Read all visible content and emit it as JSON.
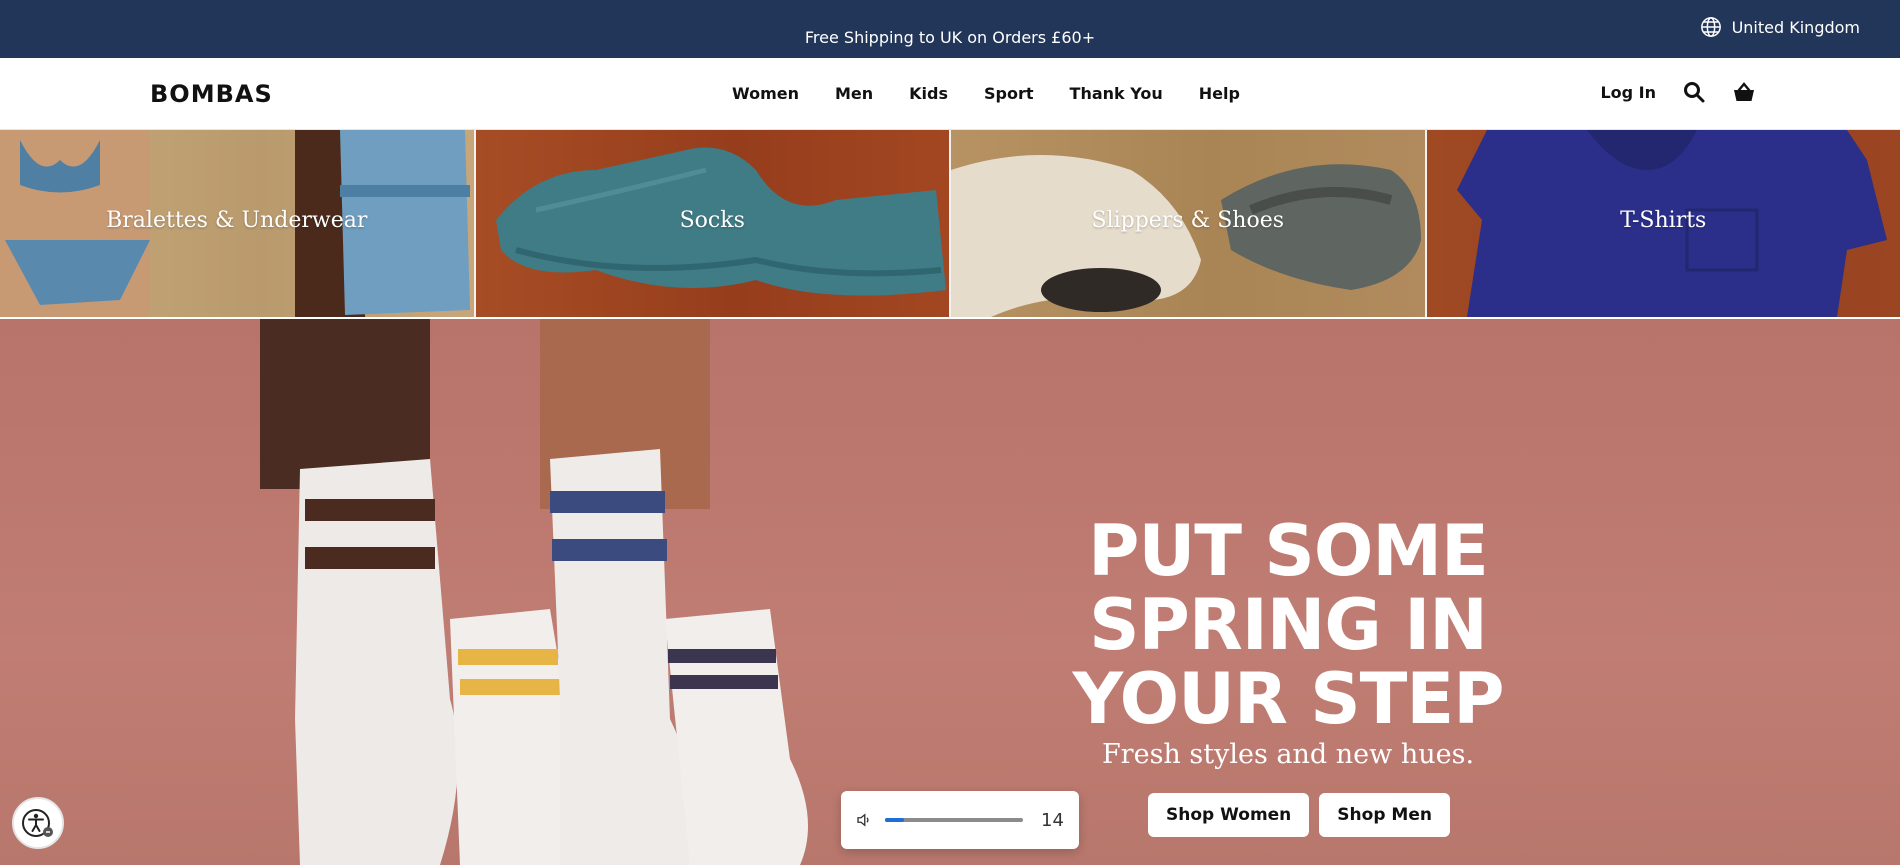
{
  "announcement": {
    "text": "Free Shipping to UK on Orders £60+",
    "region": "United Kingdom"
  },
  "header": {
    "logo": "BOMBAS",
    "nav": [
      "Women",
      "Men",
      "Kids",
      "Sport",
      "Thank You",
      "Help"
    ],
    "login": "Log In"
  },
  "categories": [
    {
      "label": "Bralettes & Underwear"
    },
    {
      "label": "Socks"
    },
    {
      "label": "Slippers & Shoes"
    },
    {
      "label": "T-Shirts"
    }
  ],
  "hero": {
    "title_line1": "PUT SOME",
    "title_line2": "SPRING IN",
    "title_line3": "YOUR STEP",
    "subtitle": "Fresh styles and new hues.",
    "button_women": "Shop Women",
    "button_men": "Shop Men"
  },
  "volume": {
    "value": "14",
    "level": 0.14
  },
  "colors": {
    "announcement_bg": "#22365a",
    "hero_bg": "#bd796f",
    "slider_fill": "#1d6fd6"
  },
  "icons": [
    "globe-icon",
    "search-icon",
    "basket-icon",
    "speaker-icon",
    "accessibility-icon"
  ]
}
